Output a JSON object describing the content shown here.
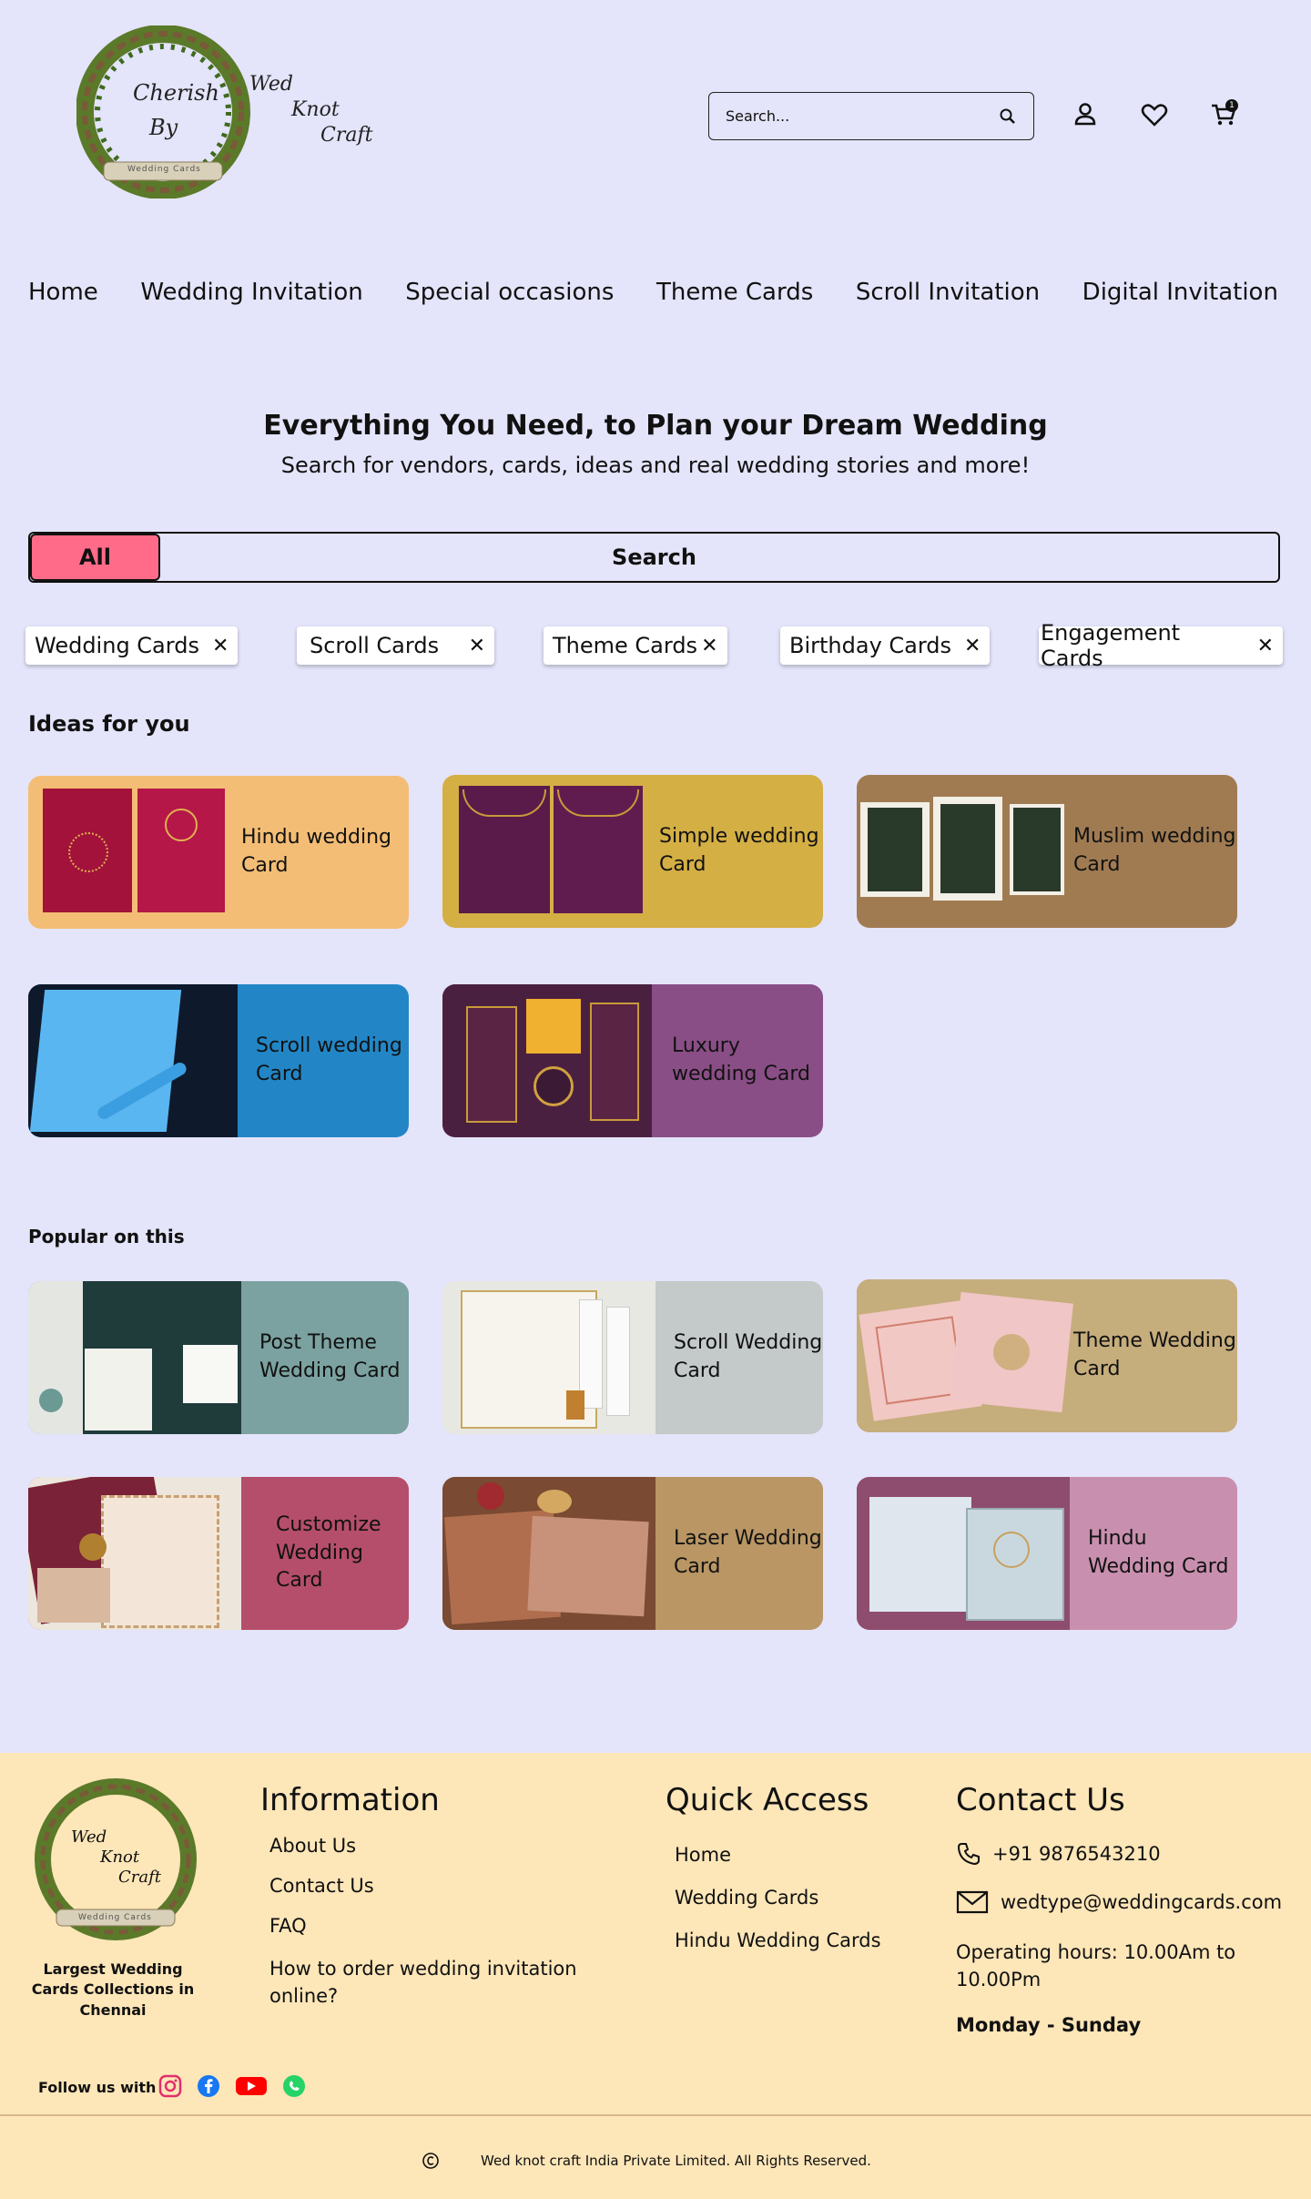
{
  "header": {
    "logo_line1": "Cherish",
    "logo_line2": "By",
    "logo_line3": "Wed",
    "logo_line4": "Knot",
    "logo_line5": "Craft",
    "logo_ribbon": "Wedding Cards",
    "search_placeholder": "Search...",
    "cart_count": "1"
  },
  "nav": [
    "Home",
    "Wedding Invitation",
    "Special occasions",
    "Theme Cards",
    "Scroll Invitation",
    "Digital Invitation"
  ],
  "hero": {
    "title": "Everything You Need, to Plan your Dream Wedding",
    "subtitle": "Search for vendors, cards, ideas and real wedding stories and more!",
    "all_label": "All",
    "search_label": "Search"
  },
  "chips": [
    "Wedding Cards",
    "Scroll Cards",
    "Theme Cards",
    "Birthday Cards",
    "Engagement Cards"
  ],
  "ideas": {
    "title": "Ideas for you",
    "cards": [
      {
        "label": "Hindu wedding Card",
        "bg": "#f4bd75"
      },
      {
        "label": "Simple wedding Card",
        "bg": "#d4af44"
      },
      {
        "label": "Muslim wedding Card",
        "bg": "#a07b52"
      },
      {
        "label": "Scroll wedding Card",
        "bg": "#2286c6"
      },
      {
        "label": "Luxury wedding Card",
        "bg": "#8a4e86"
      }
    ]
  },
  "popular": {
    "title": "Popular on this",
    "cards": [
      {
        "label": "Post Theme Wedding Card",
        "bg": "#7ba2a0"
      },
      {
        "label": "Scroll Wedding Card",
        "bg": "#c4c9c9"
      },
      {
        "label": "Theme Wedding Card",
        "bg": "#c6ad7c"
      },
      {
        "label": "Customize Wedding Card",
        "bg": "#b54e6a"
      },
      {
        "label": "Laser Wedding Card",
        "bg": "#b99664"
      },
      {
        "label": "Hindu Wedding Card",
        "bg": "#c890ae"
      }
    ]
  },
  "footer": {
    "tagline": "Largest Wedding Cards Collections in Chennai",
    "info_title": "Information",
    "info_links": [
      "About Us",
      "Contact Us",
      "FAQ",
      "How to order wedding invitation online?"
    ],
    "quick_title": "Quick Access",
    "quick_links": [
      "Home",
      "Wedding Cards",
      "Hindu Wedding Cards"
    ],
    "contact_title": "Contact Us",
    "phone": "+91 9876543210",
    "email": "wedtype@weddingcards.com",
    "hours": "Operating hours: 10.00Am to 10.00Pm",
    "days": "Monday  - Sunday",
    "follow": "Follow us with",
    "copyright": "Wed knot craft India Private Limited. All Rights Reserved."
  }
}
